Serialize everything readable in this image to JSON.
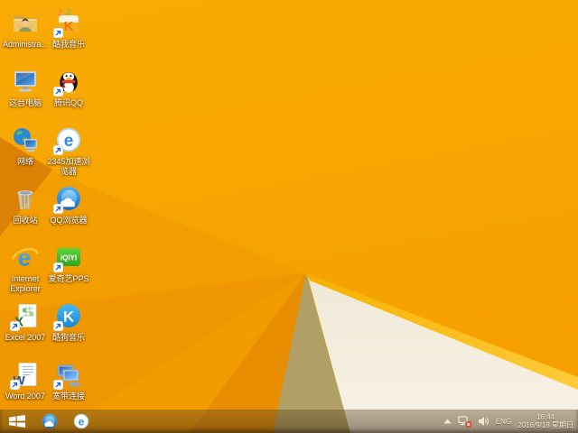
{
  "desktop": {
    "icons": [
      {
        "label": "Administra...",
        "icon": "user-folder-icon",
        "shortcut": false
      },
      {
        "label": "酷我音乐",
        "icon": "kuwo-music-icon",
        "shortcut": true
      },
      {
        "label": "这台电脑",
        "icon": "this-pc-icon",
        "shortcut": false
      },
      {
        "label": "腾讯QQ",
        "icon": "tencent-qq-penguin-icon",
        "shortcut": true
      },
      {
        "label": "网络",
        "icon": "network-globe-icon",
        "shortcut": false
      },
      {
        "label": "2345加速浏览器",
        "icon": "2345-browser-e-icon",
        "shortcut": true
      },
      {
        "label": "回收站",
        "icon": "recycle-bin-icon",
        "shortcut": false
      },
      {
        "label": "QQ浏览器",
        "icon": "qq-browser-cloud-icon",
        "shortcut": true
      },
      {
        "label": "Internet Explorer",
        "icon": "internet-explorer-icon",
        "shortcut": false
      },
      {
        "label": "爱奇艺PPS",
        "icon": "iqiyi-pps-icon",
        "shortcut": true
      },
      {
        "label": "Excel 2007",
        "icon": "excel-icon",
        "shortcut": true
      },
      {
        "label": "酷狗音乐",
        "icon": "kugou-music-icon",
        "shortcut": true
      },
      {
        "label": "Word 2007",
        "icon": "word-icon",
        "shortcut": true
      },
      {
        "label": "宽带连接",
        "icon": "broadband-connection-icon",
        "shortcut": true
      }
    ]
  },
  "taskbar": {
    "start_icon": "windows-start-icon",
    "pinned_icons": [
      "qq-browser-cloud-icon",
      "2345-browser-e-icon"
    ],
    "tray": {
      "chevron_icon": "show-hidden-icons-chevron-icon",
      "network_icon": "network-disconnected-icon",
      "volume_icon": "volume-speaker-icon",
      "language": "ENG",
      "time": "16:44",
      "date": "2016/9/18 星期日"
    }
  },
  "colors": {
    "wallpaper_orange": "#F7A600",
    "wallpaper_shade_orange": "#EE9700",
    "wallpaper_dark_fold": "#DC8103",
    "wallpaper_tan_wedge": "#B1A066",
    "wallpaper_cream": "#F3EDDD",
    "highlight_strip": "#FFC62E",
    "taskbar_tint": "#6B5533",
    "label_text": "#FFFFFF"
  }
}
